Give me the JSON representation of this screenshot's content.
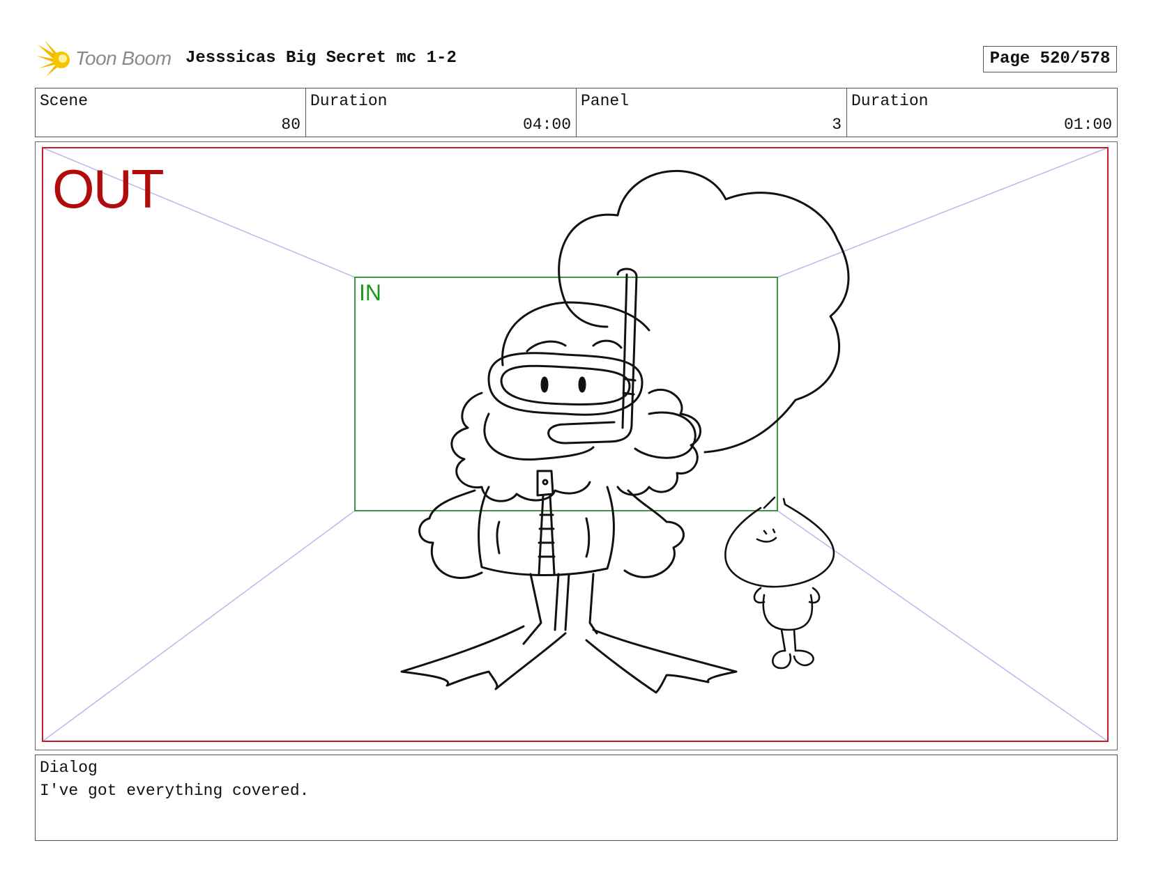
{
  "header": {
    "brand": "Toon Boom",
    "title": "Jesssicas Big Secret mc 1-2",
    "page": "Page 520/578"
  },
  "info": {
    "scene_label": "Scene",
    "scene_value": "80",
    "scene_duration_label": "Duration",
    "scene_duration_value": "04:00",
    "panel_label": "Panel",
    "panel_value": "3",
    "panel_duration_label": "Duration",
    "panel_duration_value": "01:00"
  },
  "panel": {
    "out_label": "OUT",
    "in_label": "IN"
  },
  "dialog": {
    "label": "Dialog",
    "text": "I've got everything covered."
  },
  "colors": {
    "out_frame": "#c0202a",
    "in_frame": "#2a8a2a",
    "perspective_lines": "#b8b8ee",
    "logo_star": "#f5b800"
  }
}
